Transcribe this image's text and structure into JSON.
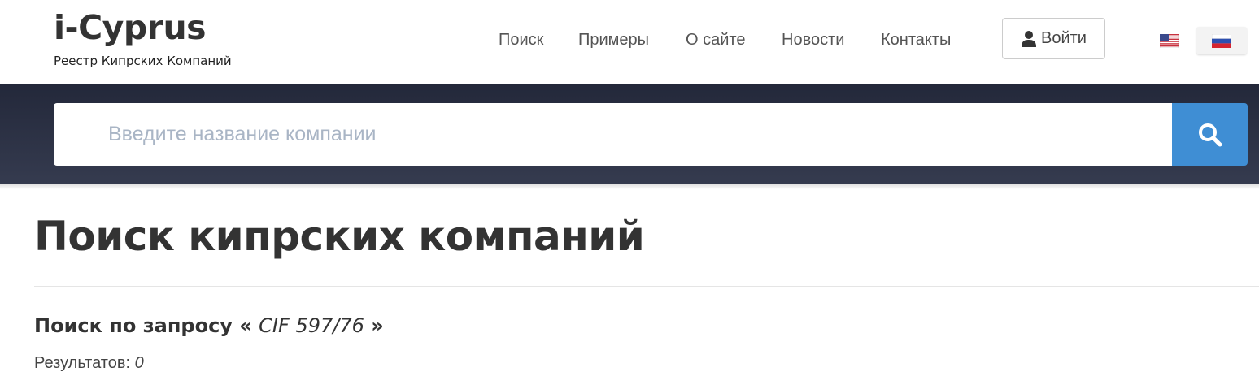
{
  "header": {
    "logo": "i-Cyprus",
    "tagline": "Реестр Кипрских Компаний",
    "nav": [
      {
        "label": "Поиск"
      },
      {
        "label": "Примеры"
      },
      {
        "label": "О сайте"
      },
      {
        "label": "Новости"
      },
      {
        "label": "Контакты"
      }
    ],
    "login_label": "Войти",
    "languages": [
      {
        "code": "en",
        "icon": "us-flag-icon",
        "active": false
      },
      {
        "code": "ru",
        "icon": "ru-flag-icon",
        "active": true
      }
    ]
  },
  "search": {
    "placeholder": "Введите название компании",
    "value": "",
    "button_icon": "search-icon",
    "button_color": "#3f8ed4"
  },
  "content": {
    "title": "Поиск кипрских компаний",
    "query_prefix": "Поиск по запросу «",
    "query_term": "CIF 597/76",
    "query_suffix": "»",
    "results_label": "Результатов:",
    "results_count": "0"
  },
  "colors": {
    "band": "#2b3042",
    "accent": "#3f8ed4"
  }
}
